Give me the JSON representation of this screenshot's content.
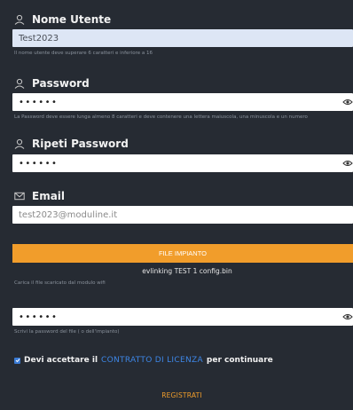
{
  "username": {
    "label": "Nome Utente",
    "icon": "user-icon",
    "value": "Test2023",
    "hint": "Il nome utente deve superare 6 caratteri e inferiore a 16"
  },
  "password": {
    "label": "Password",
    "icon": "user-icon",
    "value": "••••••",
    "hint": "La Password deve essere lunga almeno 8 caratteri e deve contenere una lettera maiuscola, una minuscola e un numero"
  },
  "repeat_password": {
    "label": "Ripeti Password",
    "icon": "user-icon",
    "value": "••••••"
  },
  "email": {
    "label": "Email",
    "icon": "envelope-icon",
    "value": "test2023@moduline.it"
  },
  "file": {
    "button_label": "FILE IMPIANTO",
    "selected_file": "evlinking TEST 1 config.bin",
    "hint": "Carica il file scaricato dal modulo wifi"
  },
  "file_password": {
    "value": "••••••",
    "hint": "Scrivi la password del file ( o dell'impianto)"
  },
  "consent": {
    "prefix": "Devi accettare il",
    "link": "CONTRATTO DI LICENZA",
    "suffix": "per continuare",
    "checked": true
  },
  "register_label": "REGISTRATI",
  "colors": {
    "background": "#262b33",
    "accent": "#f19d2b",
    "link": "#3d86e6"
  }
}
